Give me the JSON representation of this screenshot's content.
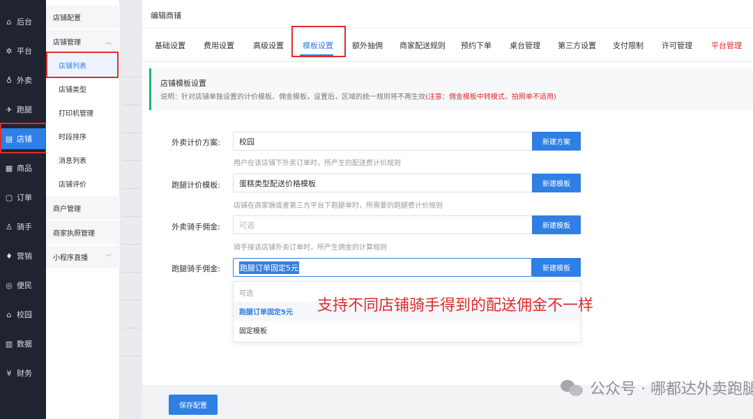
{
  "nav": {
    "items": [
      {
        "icon": "home-icon",
        "glyph": "⌂",
        "label": "后台"
      },
      {
        "icon": "gear-icon",
        "glyph": "✲",
        "label": "平台"
      },
      {
        "icon": "delivery-icon",
        "glyph": "♁",
        "label": "外卖"
      },
      {
        "icon": "runner-icon",
        "glyph": "✈",
        "label": "跑腿"
      },
      {
        "icon": "store-icon",
        "glyph": "▤",
        "label": "店铺"
      },
      {
        "icon": "goods-icon",
        "glyph": "▦",
        "label": "商品"
      },
      {
        "icon": "order-icon",
        "glyph": "▢",
        "label": "订单"
      },
      {
        "icon": "rider-icon",
        "glyph": "♙",
        "label": "骑手"
      },
      {
        "icon": "marketing-icon",
        "glyph": "♦",
        "label": "营销"
      },
      {
        "icon": "convenience-icon",
        "glyph": "◎",
        "label": "便民"
      },
      {
        "icon": "campus-icon",
        "glyph": "⌂",
        "label": "校园"
      },
      {
        "icon": "data-icon",
        "glyph": "▥",
        "label": "数据"
      },
      {
        "icon": "finance-icon",
        "glyph": "¥",
        "label": "财务"
      }
    ],
    "active_index": 4
  },
  "submenu": {
    "items": [
      {
        "label": "店铺配置",
        "kind": "group"
      },
      {
        "label": "店铺管理",
        "kind": "group",
        "caret": "︿"
      },
      {
        "label": "店铺列表",
        "kind": "child",
        "active": true
      },
      {
        "label": "店铺类型",
        "kind": "child"
      },
      {
        "label": "打印机管理",
        "kind": "child"
      },
      {
        "label": "时段排序",
        "kind": "child"
      },
      {
        "label": "消息列表",
        "kind": "child"
      },
      {
        "label": "店铺评价",
        "kind": "child"
      },
      {
        "label": "商户管理",
        "kind": "group"
      },
      {
        "label": "商家执照管理",
        "kind": "group"
      },
      {
        "label": "小程序直播",
        "kind": "group",
        "caret": "﹀"
      }
    ]
  },
  "modal": {
    "title": "编辑商铺",
    "tabs": [
      {
        "label": "基础设置"
      },
      {
        "label": "费用设置"
      },
      {
        "label": "高级设置"
      },
      {
        "label": "模板设置",
        "active": true
      },
      {
        "label": "额外抽佣"
      },
      {
        "label": "商家配送规则"
      },
      {
        "label": "预约下单"
      },
      {
        "label": "桌台管理"
      },
      {
        "label": "第三方设置"
      },
      {
        "label": "支付限制"
      },
      {
        "label": "许可管理"
      },
      {
        "label": "平台管理",
        "red": true
      }
    ],
    "notice": {
      "title": "店铺模板设置",
      "desc": "说明：针对店铺单独设置的计价模板、佣金模板，设置后，区域的统一规则将不再生效",
      "warn": "(注意：佣金模板中转模式、拍照单不适用)"
    },
    "form": {
      "rows": [
        {
          "label": "外卖计价方案:",
          "value": "校园",
          "button": "新建方案",
          "help": "用户在该店铺下外卖订单时，所产生的配送费计价规则"
        },
        {
          "label": "跑腿计价模板:",
          "value": "蛋糕类型配送价格模板",
          "button": "新建模板",
          "help": "店铺在商家端或者第三方平台下跑腿单时，所需要的跑腿费计价规则"
        },
        {
          "label": "外卖骑手佣金:",
          "placeholder": "可选",
          "button": "新建模板",
          "help": "骑手接该店铺外卖订单时，所产生佣金的计算规则"
        },
        {
          "label": "跑腿骑手佣金:",
          "value": "跑腿订单固定5元",
          "button": "新建模板"
        }
      ],
      "dropdown_options": [
        {
          "label": "可选",
          "placeholder": true
        },
        {
          "label": "跑腿订单固定5元",
          "selected": true
        },
        {
          "label": "固定模板"
        }
      ]
    },
    "save_label": "保存配置"
  },
  "annotation": "支持不同店铺骑手得到的配送佣金不一样",
  "watermark": "公众号 · 哪都达外卖跑腿系统",
  "colors": {
    "primary": "#2f7fe5",
    "sidebar_bg": "#1f2430",
    "highlight_red": "#e02b2b",
    "notice_green": "#19b36b"
  }
}
